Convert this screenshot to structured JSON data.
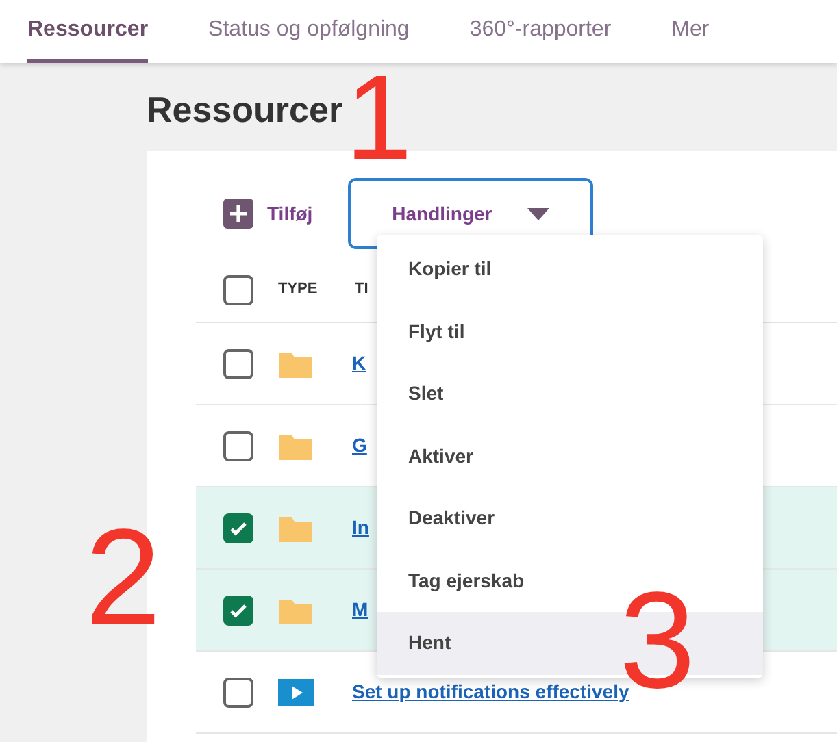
{
  "tabs": [
    {
      "label": "Ressourcer",
      "selected": true
    },
    {
      "label": "Status og opfølgning",
      "selected": false
    },
    {
      "label": "360°-rapporter",
      "selected": false
    },
    {
      "label": "Mer",
      "selected": false
    }
  ],
  "page_title": "Ressourcer",
  "toolbar": {
    "add_label": "Tilføj",
    "actions_label": "Handlinger"
  },
  "table": {
    "header_checked": false,
    "columns": [
      "TYPE",
      "TI"
    ],
    "rows": [
      {
        "kind": "folder",
        "title": "K",
        "checked": false
      },
      {
        "kind": "folder",
        "title": "G",
        "checked": false
      },
      {
        "kind": "folder",
        "title": "In",
        "checked": true
      },
      {
        "kind": "folder",
        "title": "M",
        "checked": true
      },
      {
        "kind": "video",
        "title": "Set up notifications effectively",
        "checked": false
      }
    ]
  },
  "actions_menu": [
    {
      "label": "Kopier til",
      "selected": false
    },
    {
      "label": "Flyt til",
      "selected": false
    },
    {
      "label": "Slet",
      "selected": false
    },
    {
      "label": "Aktiver",
      "selected": false
    },
    {
      "label": "Deaktiver",
      "selected": false
    },
    {
      "label": "Tag ejerskab",
      "selected": false
    },
    {
      "label": "Hent",
      "selected": true
    }
  ],
  "annotations": [
    "1",
    "2",
    "3"
  ]
}
